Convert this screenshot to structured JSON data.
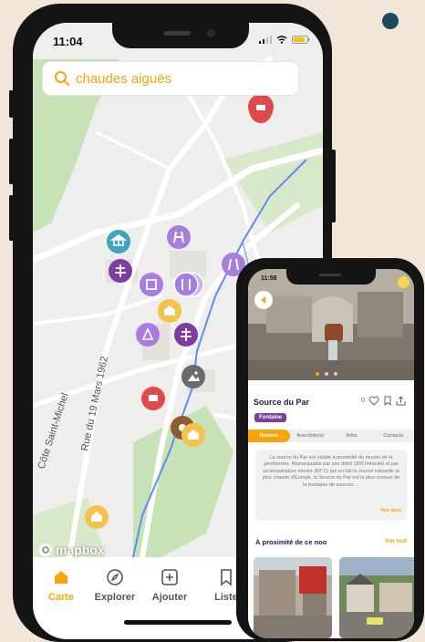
{
  "phone_main": {
    "status_time": "11:04",
    "search": {
      "query": "chaudes aiguës"
    },
    "map": {
      "attribution": "mapbox",
      "street_labels": [
        "Rue du 19 Mars 1962",
        "Côte Saint-Michel"
      ]
    },
    "tabs": [
      {
        "label": "Carte",
        "icon": "home-icon",
        "active": true
      },
      {
        "label": "Explorer",
        "icon": "compass-icon",
        "active": false
      },
      {
        "label": "Ajouter",
        "icon": "plus-square-icon",
        "active": false
      },
      {
        "label": "Liste",
        "icon": "bookmark-icon",
        "active": false
      }
    ]
  },
  "phone_detail": {
    "status_time": "11:58",
    "title": "Source du Par",
    "likes": "0",
    "tag": "Fontaine",
    "tabs": [
      "Histoire",
      "Anecdote(s)",
      "Infos",
      "Contacts"
    ],
    "description": "La source du Par est visible à proximité du musée de la géothermie. Remarquable par son débit (300 l/minute) et par sa température élevée (82°C) qui en fait la source naturelle la plus chaude d'Europe, la Source du Par est la plus connue de la trentaine de sources ...",
    "read_more": "Voir plus",
    "nearby_title": "À proximité de ce noo",
    "see_all": "Voir tout"
  },
  "colors": {
    "accent": "#f4a60c",
    "purple_pin": "#a77de0",
    "dark_purple_pin": "#7d3ea0",
    "red_pin": "#e0484c",
    "teal_pin": "#3fa4c0",
    "yellow_pin": "#f5c24b",
    "grey_pin": "#6b6b6b",
    "brown_pin": "#8e5a32",
    "background": "#f2e6d9"
  }
}
